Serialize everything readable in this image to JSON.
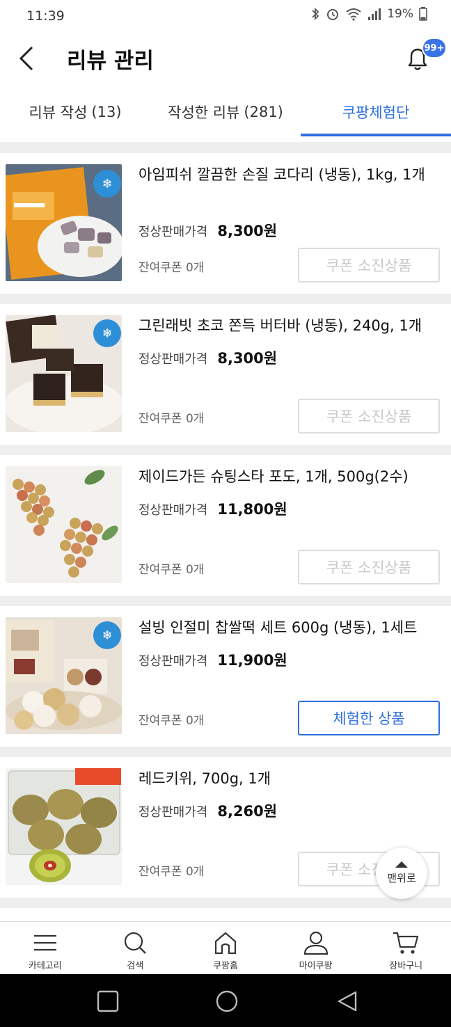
{
  "status_bar": {
    "time": "11:39",
    "battery": "19%"
  },
  "header": {
    "title": "리뷰 관리",
    "notification_badge": "99+"
  },
  "tabs": [
    {
      "label": "리뷰 작성",
      "count": "(13)",
      "active": false
    },
    {
      "label": "작성한 리뷰",
      "count": "(281)",
      "active": false
    },
    {
      "label": "쿠팡체험단",
      "count": "",
      "active": true
    }
  ],
  "price_label": "정상판매가격",
  "products": [
    {
      "name": "아임피쉬 깔끔한 손질 코다리 (냉동), 1kg, 1개",
      "price": "8,300원",
      "coupon": "잔여쿠폰 0개",
      "button": "쿠폰 소진상품",
      "button_active": false,
      "thumb": "frozen-pollack"
    },
    {
      "name": "그린래빗 초코 쫀득 버터바 (냉동), 240g, 1개",
      "price": "8,300원",
      "coupon": "잔여쿠폰 0개",
      "button": "쿠폰 소진상품",
      "button_active": false,
      "thumb": "choco-butterbar"
    },
    {
      "name": "제이드가든 슈팅스타 포도, 1개, 500g(2수)",
      "price": "11,800원",
      "coupon": "잔여쿠폰 0개",
      "button": "쿠폰 소진상품",
      "button_active": false,
      "thumb": "grapes"
    },
    {
      "name": "설빙 인절미 찹쌀떡 세트 600g (냉동), 1세트",
      "price": "11,900원",
      "coupon": "잔여쿠폰 0개",
      "button": "체험한 상품",
      "button_active": true,
      "thumb": "rice-cake"
    },
    {
      "name": "레드키위, 700g, 1개",
      "price": "8,260원",
      "coupon": "잔여쿠폰 0개",
      "button": "쿠폰 소진상품",
      "button_active": false,
      "thumb": "red-kiwi"
    }
  ],
  "scroll_top_label": "맨위로",
  "bottom_nav": [
    {
      "label": "카테고리",
      "icon": "menu-icon"
    },
    {
      "label": "검색",
      "icon": "search-icon"
    },
    {
      "label": "쿠팡홈",
      "icon": "home-icon"
    },
    {
      "label": "마이쿠팡",
      "icon": "person-icon"
    },
    {
      "label": "장바구니",
      "icon": "cart-icon"
    }
  ],
  "colors": {
    "accent": "#2f6fe0",
    "badge": "#3a73e8",
    "disabled_text": "#c8c8c8",
    "divider": "#eeeeee"
  }
}
